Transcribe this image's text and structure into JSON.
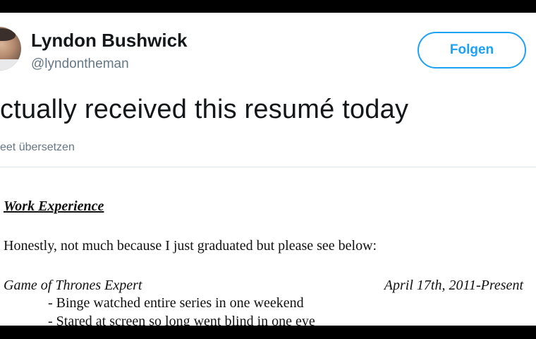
{
  "tweet": {
    "user_name": "Lyndon Bushwick",
    "user_handle": "@lyndontheman",
    "follow_label": "Folgen",
    "text": "ctually received this resumé today",
    "translate_label": "eet übersetzen"
  },
  "resume": {
    "section_heading": "Work Experience",
    "intro": "Honestly, not much because I just graduated but please see below:",
    "job_title": "Game of Thrones Expert",
    "job_dates": "April 17th, 2011-Present",
    "bullets": [
      "- Binge watched entire series in one weekend",
      "- Stared at screen so long went blind in one eye"
    ]
  },
  "colors": {
    "accent": "#1da1f2",
    "name_text": "#14171a",
    "secondary_text": "#657786",
    "divider": "#e1e8ed"
  },
  "icons": {
    "avatar": "avatar"
  }
}
